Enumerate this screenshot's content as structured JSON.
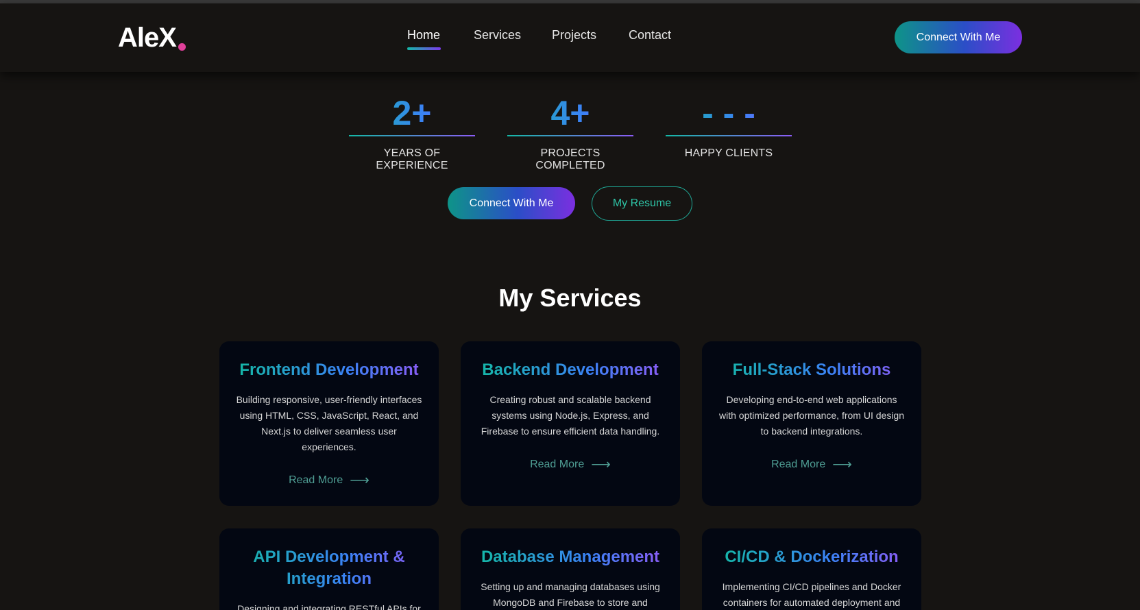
{
  "navbar": {
    "logo": "AleX",
    "links": [
      "Home",
      "Services",
      "Projects",
      "Contact"
    ],
    "active_link": "Home",
    "cta_label": "Connect With Me"
  },
  "stats": [
    {
      "value": "2+",
      "label": "YEARS OF EXPERIENCE"
    },
    {
      "value": "4+",
      "label": "PROJECTS COMPLETED"
    },
    {
      "value": "- - -",
      "label": "HAPPY CLIENTS"
    }
  ],
  "hero_buttons": {
    "connect_label": "Connect With Me",
    "resume_label": "My Resume"
  },
  "services": {
    "title": "My Services",
    "read_more_label": "Read More",
    "arrow_icon": "⟶",
    "cards": [
      {
        "title": "Frontend Development",
        "desc": "Building responsive, user-friendly interfaces using HTML, CSS, JavaScript, React, and Next.js to deliver seamless user experiences."
      },
      {
        "title": "Backend Development",
        "desc": "Creating robust and scalable backend systems using Node.js, Express, and Firebase to ensure efficient data handling."
      },
      {
        "title": "Full-Stack Solutions",
        "desc": "Developing end-to-end web applications with optimized performance, from UI design to backend integrations."
      },
      {
        "title": "API Development & Integration",
        "desc": "Designing and integrating RESTful APIs for"
      },
      {
        "title": "Database Management",
        "desc": "Setting up and managing databases using MongoDB and Firebase to store and"
      },
      {
        "title": "CI/CD & Dockerization",
        "desc": "Implementing CI/CD pipelines and Docker containers for automated deployment and"
      }
    ]
  },
  "colors": {
    "background": "#161412",
    "card_background": "#030712",
    "accent_teal": "#14b8a6",
    "accent_violet": "#8b5cf6",
    "logo_dot": "#e0409a"
  }
}
